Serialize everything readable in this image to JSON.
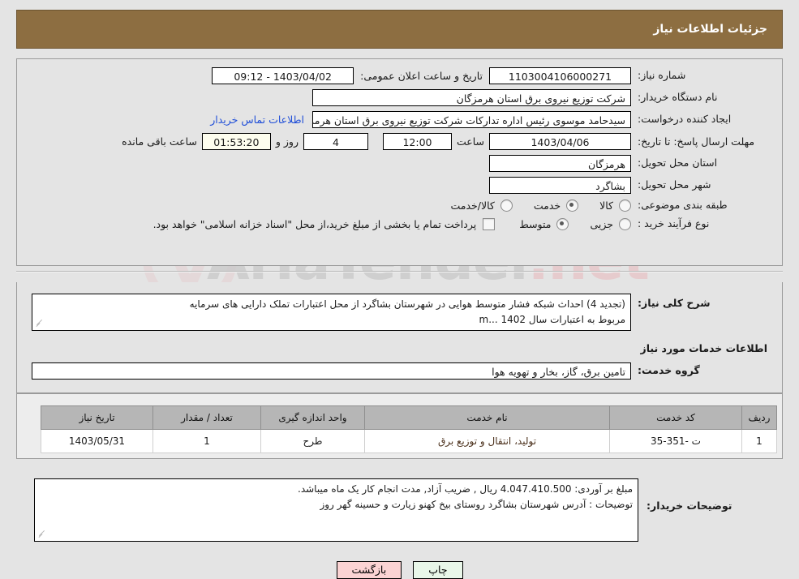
{
  "header": {
    "title": "جزئیات اطلاعات نیاز"
  },
  "form": {
    "need_number_label": "شماره نیاز:",
    "need_number_value": "1103004106000271",
    "announce_label": "تاریخ و ساعت اعلان عمومی:",
    "announce_value": "1403/04/02 - 09:12",
    "buyer_org_label": "نام دستگاه خریدار:",
    "buyer_org_value": "شرکت توزیع نیروی برق استان هرمزگان",
    "creator_label": "ایجاد کننده درخواست:",
    "creator_value": "سیدحامد موسوی رئیس اداره تدارکات شرکت توزیع نیروی برق استان هرمزگان",
    "contact_link": "اطلاعات تماس خریدار",
    "deadline_label": "مهلت ارسال پاسخ: تا تاریخ:",
    "deadline_date": "1403/04/06",
    "hour_label": "ساعت",
    "deadline_time": "12:00",
    "days_value": "4",
    "days_label": "روز و",
    "countdown_value": "01:53:20",
    "remaining_label": "ساعت باقی مانده",
    "province_label": "استان محل تحویل:",
    "province_value": "هرمزگان",
    "city_label": "شهر محل تحویل:",
    "city_value": "بشاگرد",
    "category_label": "طبقه بندی موضوعی:",
    "category_options": [
      {
        "label": "کالا",
        "selected": false
      },
      {
        "label": "خدمت",
        "selected": true
      },
      {
        "label": "کالا/خدمت",
        "selected": false
      }
    ],
    "process_label": "نوع فرآیند خرید :",
    "process_options": [
      {
        "label": "جزیی",
        "selected": false
      },
      {
        "label": "متوسط",
        "selected": true
      }
    ],
    "treasury_checkbox_text": "پرداخت تمام یا بخشی از مبلغ خرید،از محل \"اسناد خزانه اسلامی\" خواهد بود.",
    "treasury_checked": false
  },
  "description": {
    "label": "شرح کلی نیاز:",
    "line1": "(تجدید 4) احداث شبکه فشار متوسط هوایی در شهرستان بشاگرد از محل اعتبارات تملک دارایی های سرمایه",
    "line2": "مربوط به اعتبارات سال 1402 ...m"
  },
  "services": {
    "section_title": "اطلاعات خدمات مورد نیاز",
    "group_label": "گروه خدمت:",
    "group_value": "تامین برق، گاز، بخار و تهویه هوا",
    "columns": [
      "ردیف",
      "کد خدمت",
      "نام خدمت",
      "واحد اندازه گیری",
      "تعداد / مقدار",
      "تاریخ نیاز"
    ],
    "rows": [
      {
        "index": "1",
        "code": "ت -351-35",
        "name": "تولید، انتقال و توزیع برق",
        "unit": "طرح",
        "quantity": "1",
        "date": "1403/05/31"
      }
    ]
  },
  "notes": {
    "label": "توضیحات خریدار:",
    "line1": "مبلغ بر آوردی: 4.047.410.500 ریال , ضریب آزاد, مدت انجام کار یک ماه میباشد.",
    "line2": "توضیحات : آدرس شهرستان  بشاگرد روستای بیخ کهنو زیارت و حسینه گهر روز"
  },
  "footer": {
    "print_label": "چاپ",
    "back_label": "بازگشت"
  },
  "watermark": {
    "text_left": "AriaTender",
    "text_right": ".net"
  }
}
